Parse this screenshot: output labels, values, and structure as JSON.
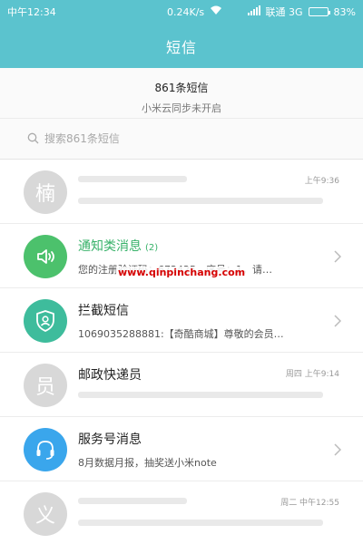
{
  "status_bar": {
    "time": "中午12:34",
    "speed": "0.24K/s",
    "carrier": "联通 3G",
    "battery": "83%",
    "battery_level": 0.83
  },
  "header": {
    "title": "短信"
  },
  "summary": {
    "count_text": "861条短信",
    "sync_text": "小米云同步未开启"
  },
  "search": {
    "placeholder": "搜索861条短信"
  },
  "conversations": [
    {
      "avatar_char": "楠",
      "title": "",
      "preview": "",
      "time": "上午9:36"
    },
    {
      "title": "通知类消息",
      "badge": "(2)",
      "preview": "您的注册验证码：672425，序号：1，请…",
      "time": ""
    },
    {
      "title": "拦截短信",
      "preview": "1069035288881:【奇酷商城】尊敬的会员…",
      "time": ""
    },
    {
      "avatar_char": "员",
      "title": "邮政快递员",
      "preview": "",
      "time": "周四 上午9:14"
    },
    {
      "title": "服务号消息",
      "preview": "8月数据月报，抽奖送小米note",
      "time": ""
    },
    {
      "avatar_char": "义",
      "title": "",
      "preview": "",
      "time": "周二 中午12:55"
    }
  ],
  "watermark": "www.qinpinchang.com",
  "colors": {
    "header": "#5bc3ce",
    "notification_green": "#4cc16c",
    "intercept_teal": "#3ebc9c",
    "service_blue": "#3aa6ec",
    "avatar_gray": "#d8d8d8",
    "watermark_red": "#d60000"
  },
  "icons": {
    "search": "search-icon",
    "notification": "speaker-icon",
    "intercept": "shield-user-icon",
    "service": "headset-icon",
    "row_arrow": "chevron-right-icon",
    "wifi": "wifi-icon",
    "signal": "signal-icon",
    "battery": "battery-icon"
  }
}
